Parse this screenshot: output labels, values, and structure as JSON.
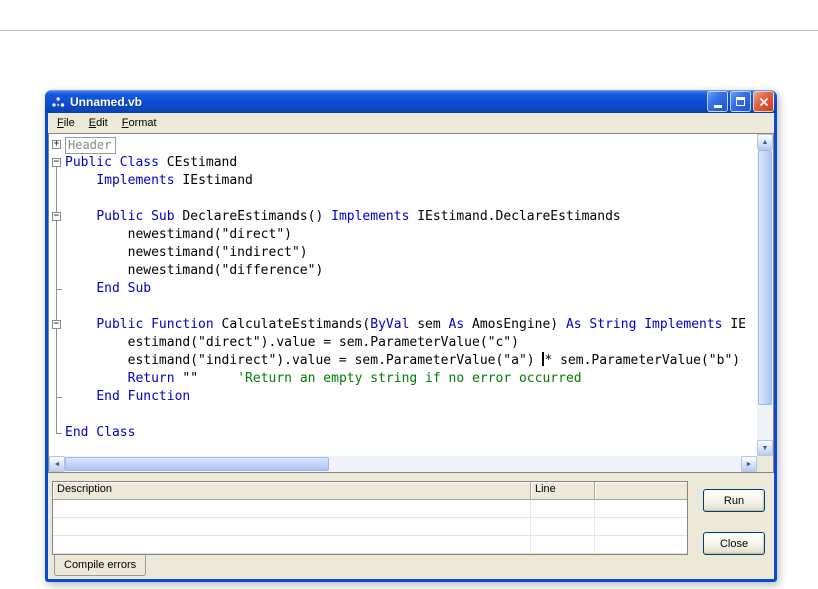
{
  "window": {
    "title": "Unnamed.vb",
    "menu": [
      "File",
      "Edit",
      "Format"
    ],
    "colors": {
      "keyword": "#0000CC",
      "comment": "#007E00",
      "titlebar_blue": "#0B4ACB",
      "panel_gray": "#ECE9D8"
    },
    "icons": {
      "scroll_up": "▲",
      "scroll_down": "▼",
      "scroll_left": "◄",
      "scroll_right": "►"
    },
    "code_lines": [
      {
        "fold": "plus",
        "segments": [
          {
            "t": "Header",
            "c": "hdr"
          }
        ]
      },
      {
        "fold": "minus-start",
        "segments": [
          {
            "t": "Public Class ",
            "c": "k"
          },
          {
            "t": "CEstimand",
            "c": "n"
          }
        ]
      },
      {
        "fold": "line",
        "segments": [
          {
            "t": "    ",
            "c": "n"
          },
          {
            "t": "Implements",
            "c": "k"
          },
          {
            "t": " IEstimand",
            "c": "n"
          }
        ]
      },
      {
        "fold": "line",
        "segments": []
      },
      {
        "fold": "minus",
        "segments": [
          {
            "t": "    ",
            "c": "n"
          },
          {
            "t": "Public Sub ",
            "c": "k"
          },
          {
            "t": "DeclareEstimands() ",
            "c": "n"
          },
          {
            "t": "Implements",
            "c": "k"
          },
          {
            "t": " IEstimand.DeclareEstimands",
            "c": "n"
          }
        ]
      },
      {
        "fold": "line",
        "segments": [
          {
            "t": "        newestimand(\"direct\")",
            "c": "n"
          }
        ]
      },
      {
        "fold": "line",
        "segments": [
          {
            "t": "        newestimand(\"indirect\")",
            "c": "n"
          }
        ]
      },
      {
        "fold": "line",
        "segments": [
          {
            "t": "        newestimand(\"difference\")",
            "c": "n"
          }
        ]
      },
      {
        "fold": "tick",
        "segments": [
          {
            "t": "    ",
            "c": "n"
          },
          {
            "t": "End Sub",
            "c": "k"
          }
        ]
      },
      {
        "fold": "line",
        "segments": []
      },
      {
        "fold": "minus",
        "segments": [
          {
            "t": "    ",
            "c": "n"
          },
          {
            "t": "Public Function ",
            "c": "k"
          },
          {
            "t": "CalculateEstimands(",
            "c": "n"
          },
          {
            "t": "ByVal",
            "c": "k"
          },
          {
            "t": " sem ",
            "c": "n"
          },
          {
            "t": "As",
            "c": "k"
          },
          {
            "t": " AmosEngine) ",
            "c": "n"
          },
          {
            "t": "As String",
            "c": "k"
          },
          {
            "t": " ",
            "c": "n"
          },
          {
            "t": "Implements",
            "c": "k"
          },
          {
            "t": " IE",
            "c": "n"
          }
        ]
      },
      {
        "fold": "line",
        "segments": [
          {
            "t": "        estimand(\"direct\").value = sem.ParameterValue(\"c\")",
            "c": "n"
          }
        ]
      },
      {
        "fold": "line",
        "segments": [
          {
            "t": "        estimand(\"indirect\").value = sem.ParameterValue(\"a\") ",
            "c": "n"
          },
          {
            "caret": true
          },
          {
            "t": "* sem.ParameterValue(\"b\")",
            "c": "n"
          }
        ]
      },
      {
        "fold": "line",
        "segments": [
          {
            "t": "        ",
            "c": "n"
          },
          {
            "t": "Return",
            "c": "k"
          },
          {
            "t": " \"\"     ",
            "c": "n"
          },
          {
            "t": "'Return an empty string if no error occurred",
            "c": "c"
          }
        ]
      },
      {
        "fold": "tick",
        "segments": [
          {
            "t": "    ",
            "c": "n"
          },
          {
            "t": "End Function",
            "c": "k"
          }
        ]
      },
      {
        "fold": "line",
        "segments": []
      },
      {
        "fold": "corner",
        "segments": [
          {
            "t": "End Class",
            "c": "k"
          }
        ]
      }
    ],
    "scrollbars": {
      "v_thumb_top_pct": 0,
      "v_thumb_height_pct": 88,
      "h_thumb_left_pct": 0,
      "h_thumb_width_pct": 39
    },
    "error_panel": {
      "columns": [
        "Description",
        "Line",
        ""
      ],
      "rows": [],
      "visible_empty_rows": 3,
      "tab_label": "Compile errors"
    },
    "buttons": {
      "run": "Run",
      "close": "Close"
    }
  }
}
